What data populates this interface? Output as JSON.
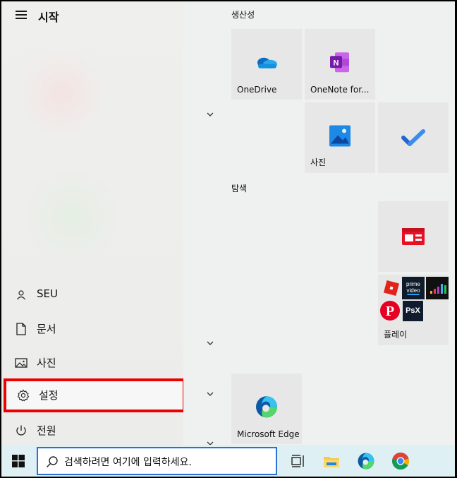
{
  "start_menu": {
    "title": "시작",
    "rail_items": [
      {
        "label": "SEU",
        "icon": "user-icon"
      },
      {
        "label": "문서",
        "icon": "document-icon"
      },
      {
        "label": "사진",
        "icon": "pictures-icon"
      },
      {
        "label": "설정",
        "icon": "gear-icon"
      },
      {
        "label": "전원",
        "icon": "power-icon"
      }
    ],
    "groups": [
      {
        "title": "생산성"
      },
      {
        "title": "탐색"
      }
    ],
    "tiles": {
      "onedrive": "OneDrive",
      "onenote": "OneNote for...",
      "photos": "사진",
      "todo": "",
      "news": "",
      "play": "플레이",
      "edge": "Microsoft Edge"
    },
    "play_apps": {
      "prime_line1": "prime",
      "prime_line2": "video",
      "psx": "PsX"
    }
  },
  "taskbar": {
    "search_placeholder": "검색하려면 여기에 입력하세요."
  },
  "colors": {
    "highlight_border": "#ee0000",
    "search_border": "#2b6fd6",
    "taskbar_bg": "#dff0f4"
  }
}
